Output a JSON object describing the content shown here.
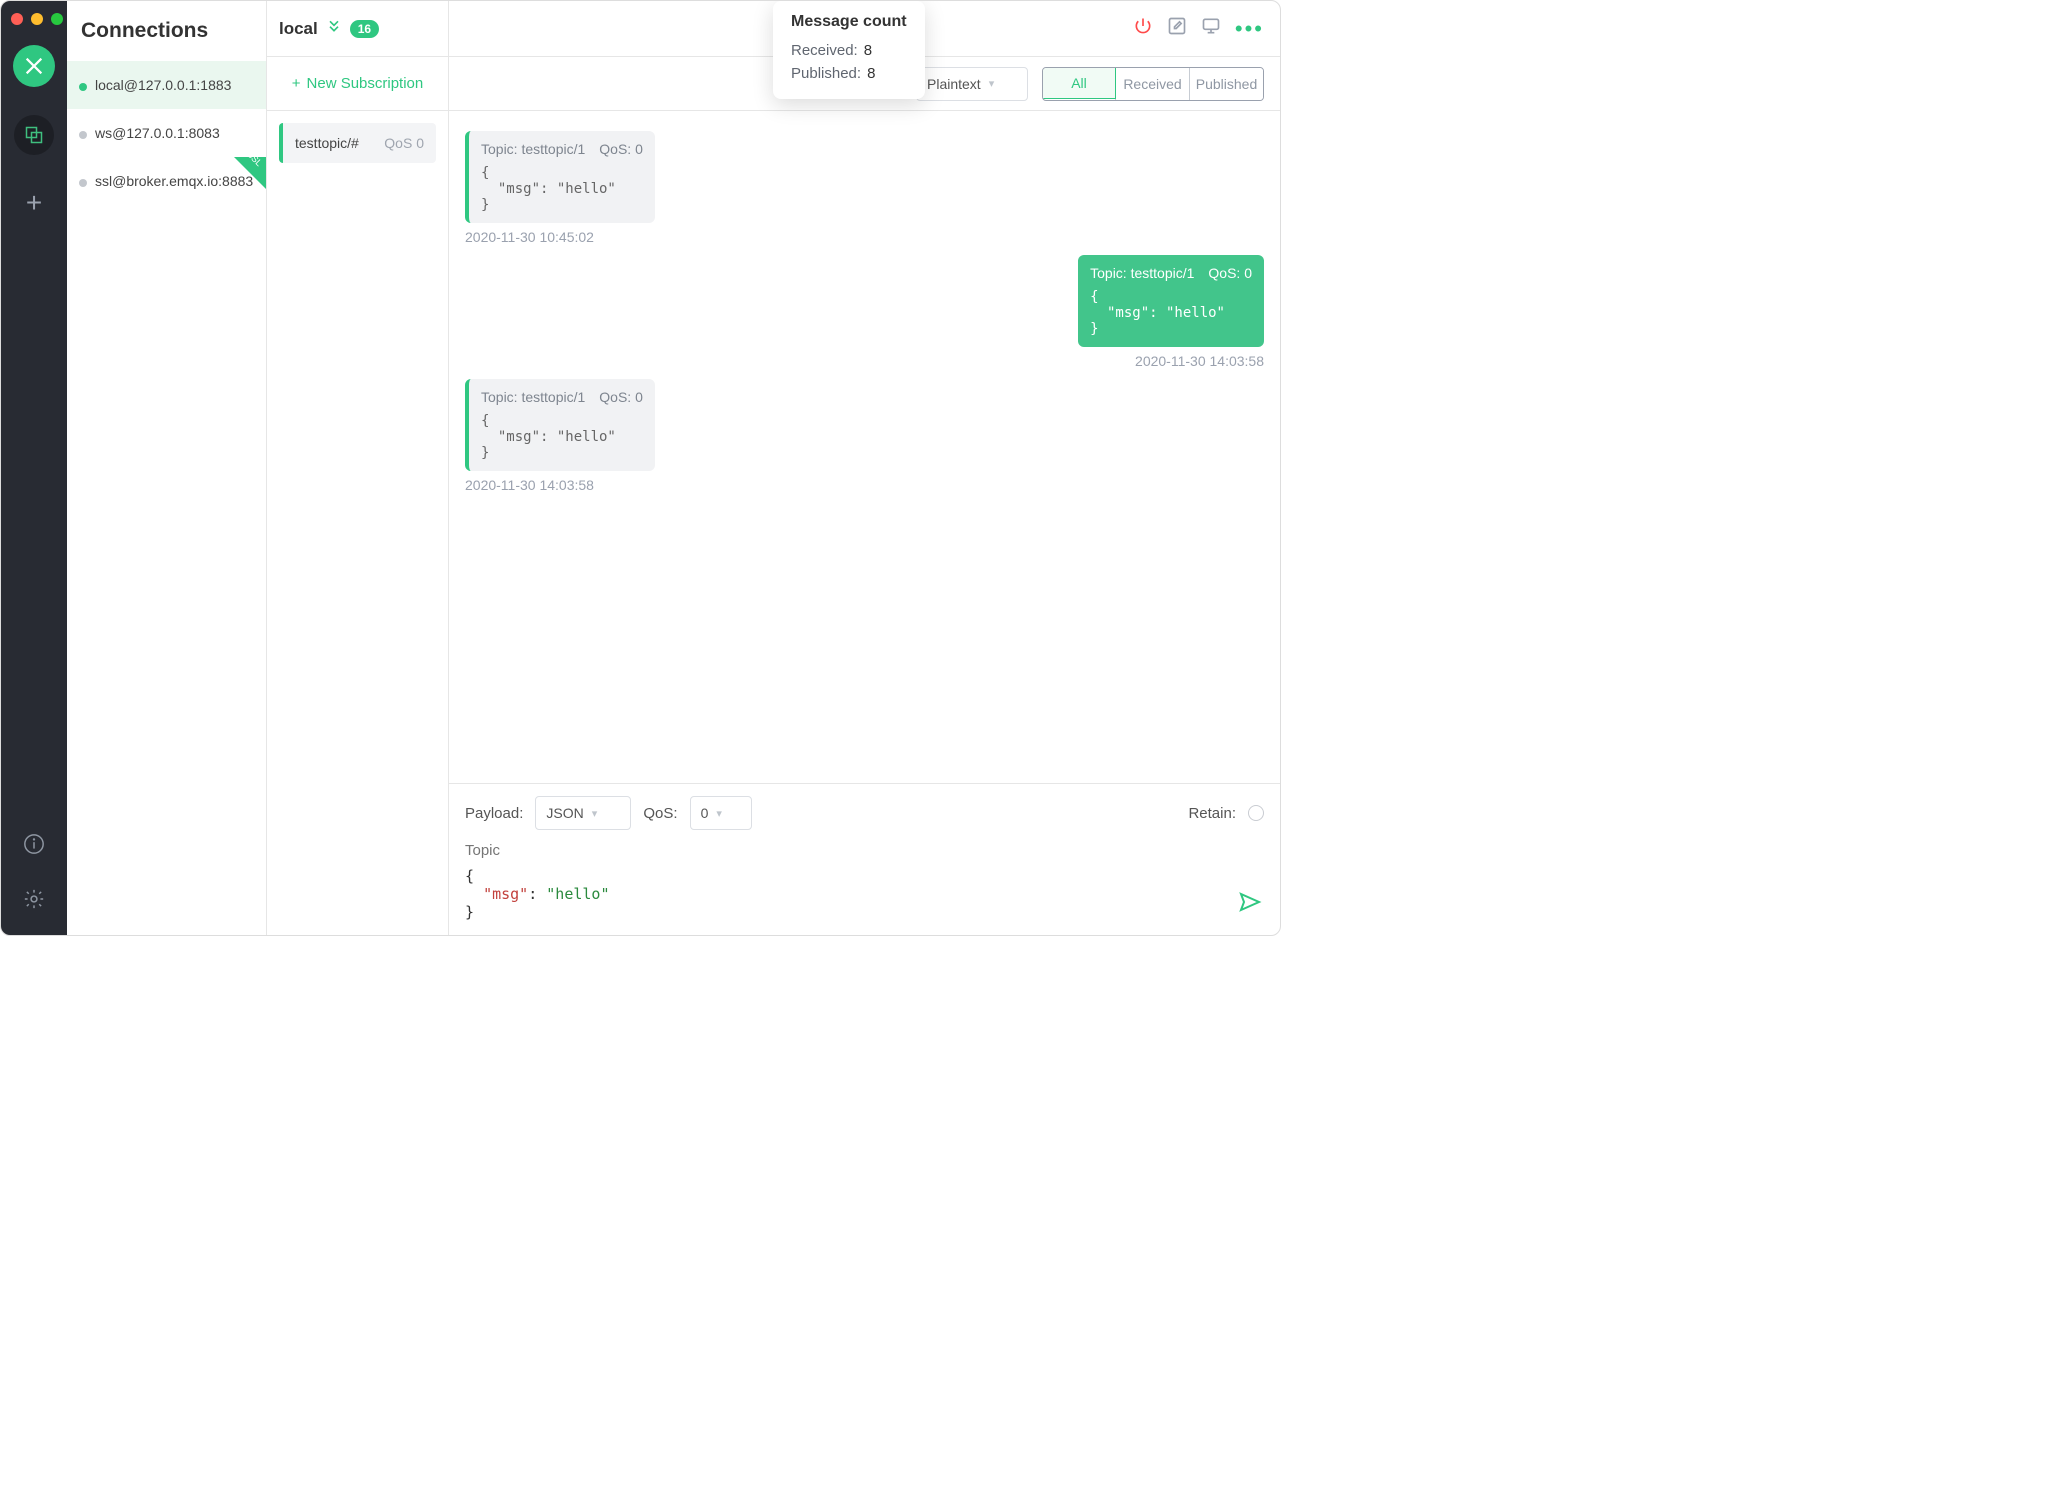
{
  "sidebar": {
    "title": "Connections",
    "items": [
      {
        "label": "local@127.0.0.1:1883",
        "status": "online",
        "ssl": false,
        "active": true
      },
      {
        "label": "ws@127.0.0.1:8083",
        "status": "offline",
        "ssl": false,
        "active": false
      },
      {
        "label": "ssl@broker.emqx.io:8883",
        "status": "offline",
        "ssl": true,
        "active": false
      }
    ],
    "ssl_badge": "SSL"
  },
  "header": {
    "connection_name": "local",
    "badge_count": "16"
  },
  "popover": {
    "title": "Message count",
    "received_label": "Received:",
    "received_value": "8",
    "published_label": "Published:",
    "published_value": "8"
  },
  "subscriptions": {
    "new_label": "New Subscription",
    "items": [
      {
        "topic": "testtopic/#",
        "qos": "QoS 0"
      }
    ]
  },
  "toolbar": {
    "format_selected": "Plaintext",
    "filters": {
      "all": "All",
      "received": "Received",
      "published": "Published"
    }
  },
  "messages": [
    {
      "direction": "received",
      "topic_label": "Topic: testtopic/1",
      "qos_label": "QoS: 0",
      "payload": "{\n  \"msg\": \"hello\"\n}",
      "timestamp": "2020-11-30 10:45:02"
    },
    {
      "direction": "sent",
      "topic_label": "Topic: testtopic/1",
      "qos_label": "QoS: 0",
      "payload": "{\n  \"msg\": \"hello\"\n}",
      "timestamp": "2020-11-30 14:03:58"
    },
    {
      "direction": "received",
      "topic_label": "Topic: testtopic/1",
      "qos_label": "QoS: 0",
      "payload": "{\n  \"msg\": \"hello\"\n}",
      "timestamp": "2020-11-30 14:03:58"
    }
  ],
  "publish": {
    "payload_label": "Payload:",
    "payload_format": "JSON",
    "qos_label": "QoS:",
    "qos_value": "0",
    "retain_label": "Retain:",
    "topic_placeholder": "Topic",
    "editor_brace_open": "{",
    "editor_key": "\"msg\"",
    "editor_colon": ": ",
    "editor_value": "\"hello\"",
    "editor_brace_close": "}"
  }
}
